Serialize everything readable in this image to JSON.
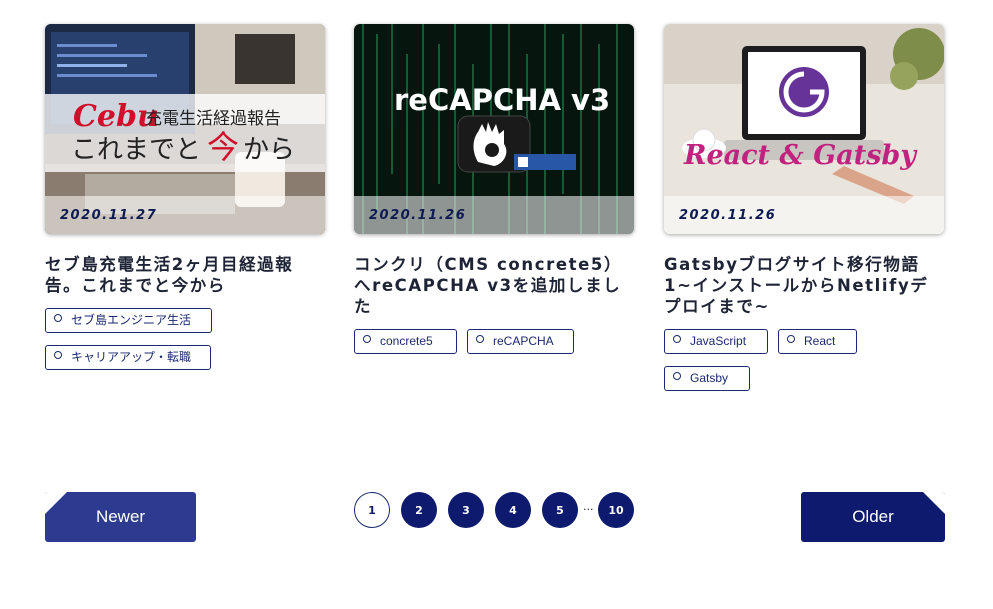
{
  "posts": [
    {
      "date": "2020.11.27",
      "image_text": {
        "script": "Cebu",
        "line1": "充電生活経過報告",
        "line2a": "これまでと",
        "line2b": "今",
        "line2c": "から"
      },
      "title": "セブ島充電生活2ヶ月目経過報告。これまでと今から",
      "tags": [
        "セブ島エンジニア生活",
        "キャリアアップ・転職"
      ]
    },
    {
      "date": "2020.11.26",
      "image_text": {
        "heading": "reCAPCHA v3"
      },
      "title": "コンクリ（CMS concrete5）へreCAPCHA v3を追加しました",
      "tags": [
        "concrete5",
        "reCAPCHA"
      ]
    },
    {
      "date": "2020.11.26",
      "image_text": {
        "overlay": "React & Gatsby"
      },
      "title": "Gatsbyブログサイト移行物語1~インストールからNetlifyデプロイまで~",
      "tags": [
        "JavaScript",
        "React",
        "Gatsby"
      ]
    }
  ],
  "pagination": {
    "newer_label": "Newer",
    "older_label": "Older",
    "pages": [
      "1",
      "2",
      "3",
      "4",
      "5"
    ],
    "ellipsis": "...",
    "last_page": "10",
    "current": "1"
  },
  "colors": {
    "accent": "#0e1a6e",
    "newer_button": "#2c3b8f",
    "text": "#1e2436"
  }
}
